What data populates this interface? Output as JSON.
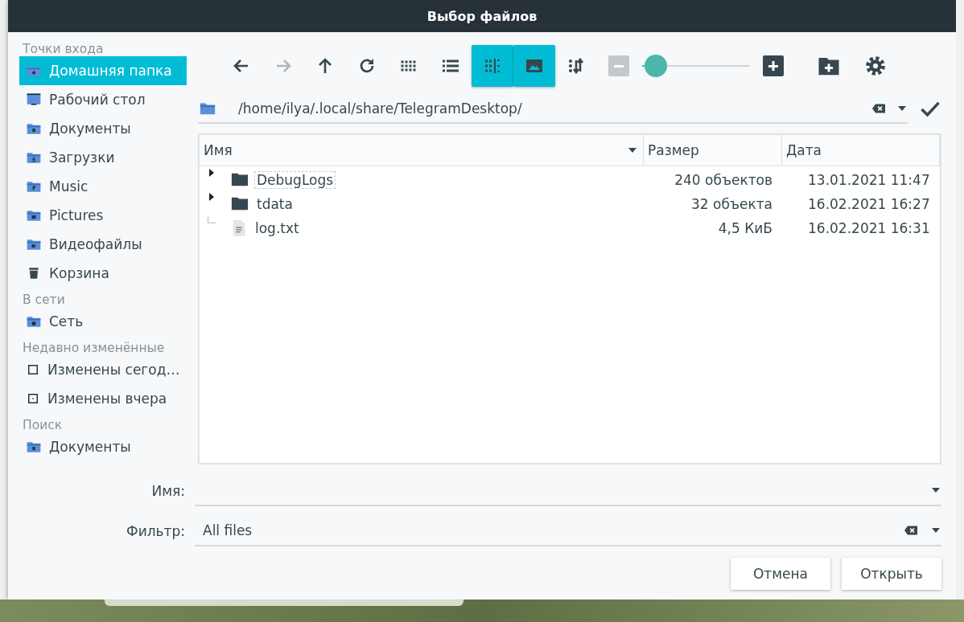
{
  "window": {
    "title": "Выбор файлов"
  },
  "sidebar": {
    "sections": [
      {
        "title": "Точки входа",
        "items": [
          {
            "label": "Домашняя папка",
            "kind": "home",
            "selected": true
          },
          {
            "label": "Рабочий стол",
            "kind": "desktop",
            "selected": false
          },
          {
            "label": "Документы",
            "kind": "documents",
            "selected": false
          },
          {
            "label": "Загрузки",
            "kind": "downloads",
            "selected": false
          },
          {
            "label": "Music",
            "kind": "music",
            "selected": false
          },
          {
            "label": "Pictures",
            "kind": "pictures",
            "selected": false
          },
          {
            "label": "Видеофайлы",
            "kind": "videos",
            "selected": false
          },
          {
            "label": "Корзина",
            "kind": "trash",
            "selected": false
          }
        ]
      },
      {
        "title": "В сети",
        "items": [
          {
            "label": "Сеть",
            "kind": "network",
            "selected": false
          }
        ]
      },
      {
        "title": "Недавно изменённые",
        "items": [
          {
            "label": "Изменены сегод…",
            "kind": "today",
            "selected": false
          },
          {
            "label": "Изменены вчера",
            "kind": "yesterday",
            "selected": false
          }
        ]
      },
      {
        "title": "Поиск",
        "items": [
          {
            "label": "Документы",
            "kind": "documents",
            "selected": false
          }
        ]
      }
    ]
  },
  "toolbar": [
    {
      "kind": "back",
      "selected": false,
      "disabled": false
    },
    {
      "kind": "forward",
      "selected": false,
      "disabled": true
    },
    {
      "kind": "up",
      "selected": false,
      "disabled": false
    },
    {
      "kind": "reload",
      "selected": false,
      "disabled": false
    },
    {
      "kind": "icons",
      "selected": false,
      "disabled": false
    },
    {
      "kind": "list",
      "selected": false,
      "disabled": false
    },
    {
      "kind": "details",
      "selected": true,
      "disabled": false
    },
    {
      "kind": "preview",
      "selected": true,
      "disabled": false
    },
    {
      "kind": "sort",
      "selected": false,
      "disabled": false
    }
  ],
  "zoom": {
    "minus_disabled": true,
    "level": 0.13
  },
  "path": {
    "value": "/home/ilya/.local/share/TelegramDesktop/"
  },
  "table": {
    "columns": [
      {
        "label": "Имя",
        "sorted": true
      },
      {
        "label": "Размер",
        "sorted": false
      },
      {
        "label": "Дата",
        "sorted": false
      }
    ],
    "rows": [
      {
        "name": "DebugLogs",
        "kind": "folder",
        "expanded": false,
        "focused": true,
        "size": "240 объектов",
        "date": "13.01.2021 11:47"
      },
      {
        "name": "tdata",
        "kind": "folder",
        "expanded": false,
        "focused": false,
        "size": "32 объекта",
        "date": "16.02.2021 16:27"
      },
      {
        "name": "log.txt",
        "kind": "file",
        "focused": false,
        "size": "4,5 КиБ",
        "date": "16.02.2021 16:31"
      }
    ]
  },
  "name_field": {
    "label": "Имя:"
  },
  "filter_field": {
    "label": "Фильтр:",
    "value": "All files"
  },
  "buttons": [
    "Отмена",
    "Открыть"
  ]
}
